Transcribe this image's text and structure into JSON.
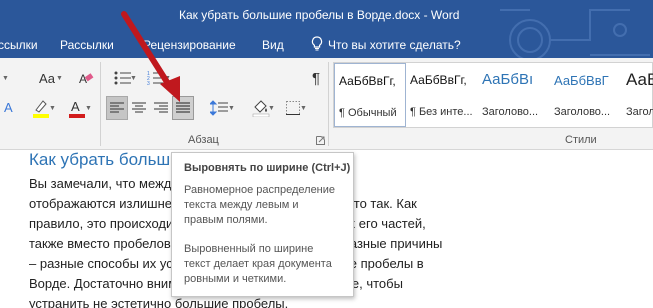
{
  "window": {
    "title": "Как убрать большие пробелы в Ворде.docx - Word"
  },
  "tabs": [
    {
      "label": "ссылки"
    },
    {
      "label": "Рассылки"
    },
    {
      "label": "Рецензирование"
    },
    {
      "label": "Вид"
    }
  ],
  "tell_me": {
    "placeholder": "Что вы хотите сделать?"
  },
  "ribbon": {
    "font_size_label": "Aa",
    "paragraph_group": "Абзац",
    "styles_group": "Стили",
    "pilcrow": "¶",
    "styles": [
      {
        "preview": "АаБбВвГг,",
        "name": "¶ Обычный"
      },
      {
        "preview": "АаБбВвГг,",
        "name": "¶ Без инте..."
      },
      {
        "preview": "АаБбВı",
        "name": "Заголово..."
      },
      {
        "preview": "АаБбВвГ",
        "name": "Заголово..."
      },
      {
        "preview": "АаБ",
        "name": "Заголово..."
      }
    ]
  },
  "document": {
    "heading": "Как убрать больш",
    "lines": [
      "Вы замечали, что межд                                              вом редакторе Microsoft Word",
      "отображаются излишне                                           и появляются далеко не просто так. Как",
      "правило, это происходи                                          ования текста или отдельных его частей,",
      "также вместо пробелов                                           иальные символы. То есть, разные причины",
      "– разные способы их уст                                          узнаете, как убрать большие пробелы в",
      "Ворде. Достаточно внима                                          и запомнить её содержимое, чтобы",
      "устранить не эстетично большие пробелы."
    ]
  },
  "tooltip": {
    "title": "Выровнять по ширине (Ctrl+J)",
    "text1": "Равномерное распределение текста между левым и правым полями.",
    "text2": "Выровненный по ширине текст делает края документа ровными и четкими."
  },
  "colors": {
    "word_blue": "#2b579a",
    "heading_blue": "#2e74b5",
    "arrow_red": "#c0181e",
    "ribbon_bg": "#f3f3f3"
  },
  "icons": [
    "lightbulb-icon",
    "align-left-icon",
    "align-center-icon",
    "align-right-icon",
    "justify-icon",
    "bullets-icon",
    "numbering-icon",
    "line-spacing-icon",
    "shading-icon",
    "borders-icon",
    "font-color-icon",
    "highlight-icon",
    "clear-formatting-icon",
    "dialog-launcher-icon",
    "pilcrow-icon"
  ]
}
